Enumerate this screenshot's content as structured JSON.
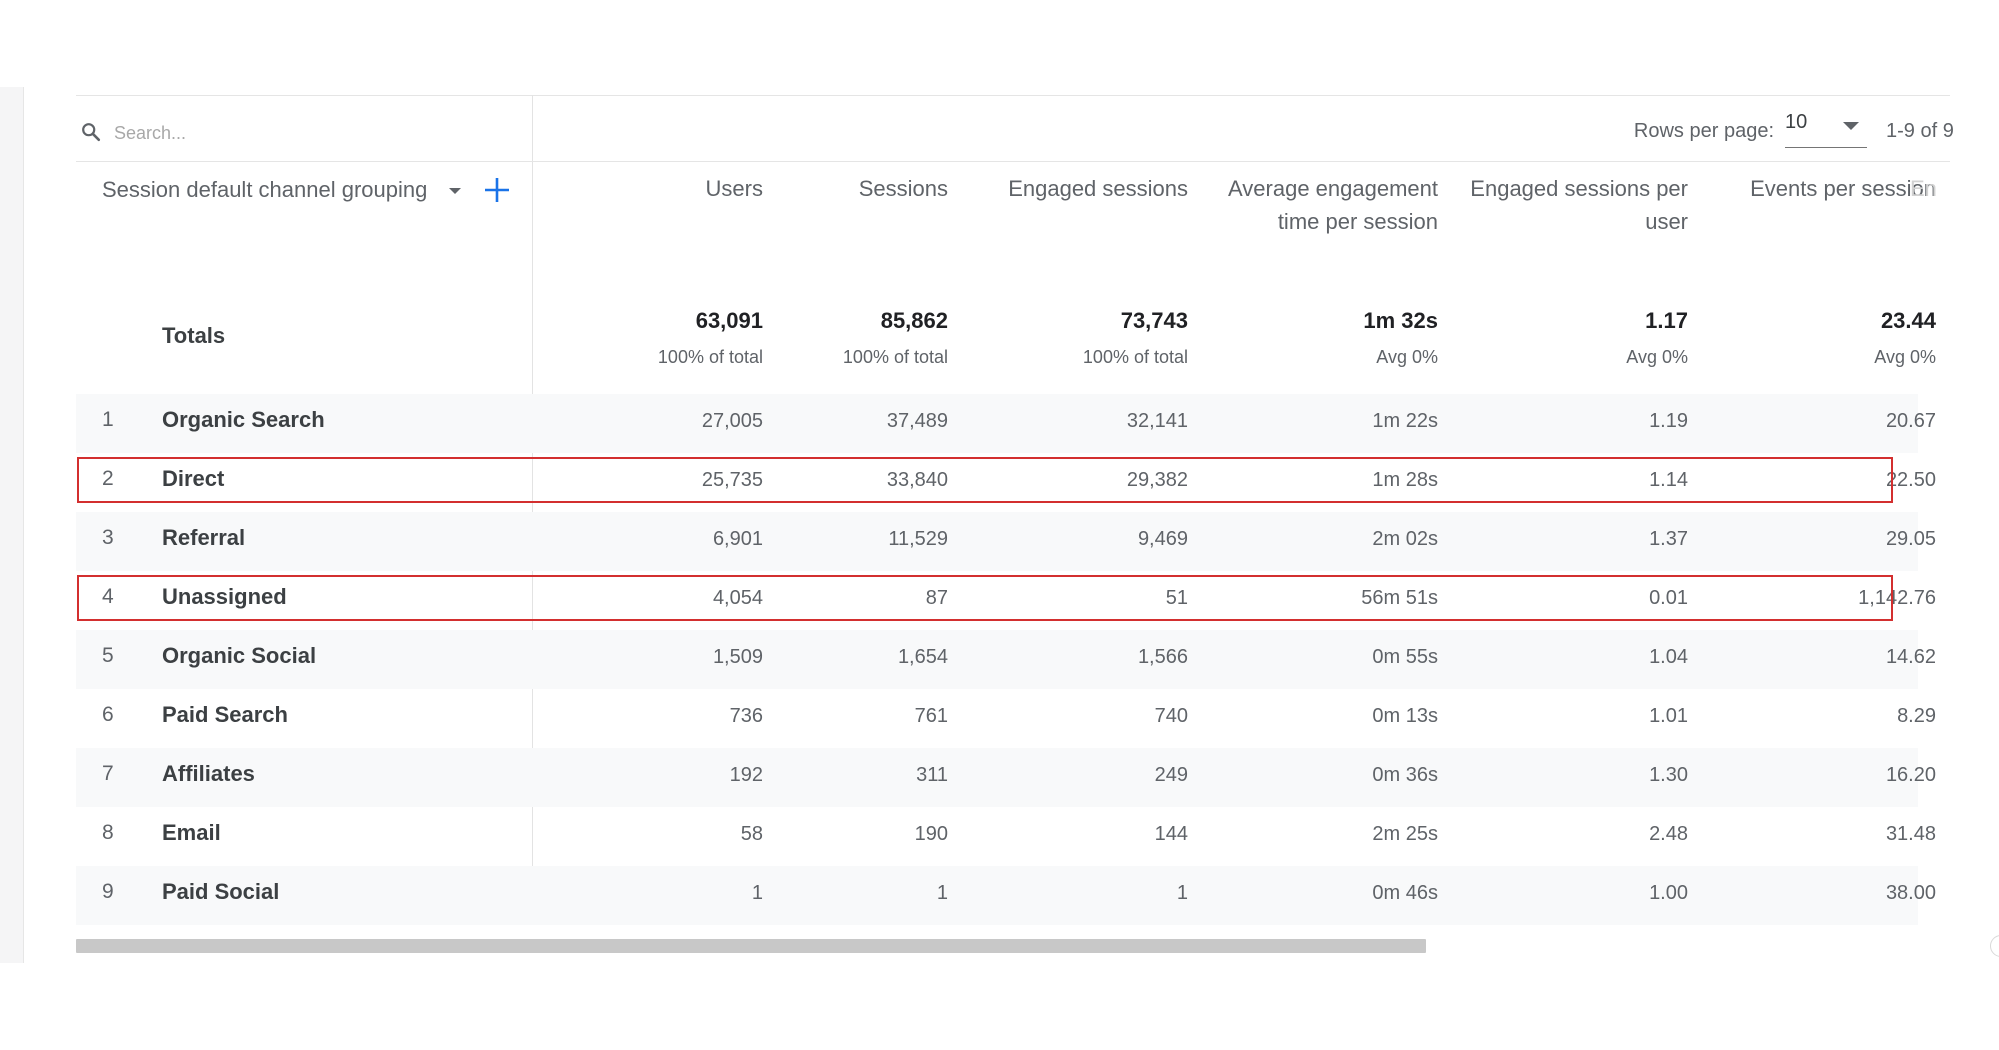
{
  "search": {
    "placeholder": "Search..."
  },
  "pagination": {
    "rows_per_page_label": "Rows per page:",
    "rows_per_page_value": "10",
    "range_text": "1-9 of 9"
  },
  "table": {
    "dimension_header": "Session default channel grouping",
    "columns": [
      {
        "key": "users",
        "label": "Users"
      },
      {
        "key": "sessions",
        "label": "Sessions"
      },
      {
        "key": "engaged_sessions",
        "label": "Engaged sessions"
      },
      {
        "key": "avg_engagement",
        "label": "Average engagement time per session"
      },
      {
        "key": "engaged_per_user",
        "label": "Engaged sessions per user"
      },
      {
        "key": "events_per_session",
        "label": "Events per session"
      },
      {
        "key": "cut_off",
        "label": "En"
      }
    ],
    "totals": {
      "label": "Totals",
      "values": [
        "63,091",
        "85,862",
        "73,743",
        "1m 32s",
        "1.17",
        "23.44"
      ],
      "subs": [
        "100% of total",
        "100% of total",
        "100% of total",
        "Avg 0%",
        "Avg 0%",
        "Avg 0%"
      ]
    },
    "rows": [
      {
        "num": "1",
        "name": "Organic Search",
        "values": [
          "27,005",
          "37,489",
          "32,141",
          "1m 22s",
          "1.19",
          "20.67"
        ],
        "highlighted": false
      },
      {
        "num": "2",
        "name": "Direct",
        "values": [
          "25,735",
          "33,840",
          "29,382",
          "1m 28s",
          "1.14",
          "22.50"
        ],
        "highlighted": true
      },
      {
        "num": "3",
        "name": "Referral",
        "values": [
          "6,901",
          "11,529",
          "9,469",
          "2m 02s",
          "1.37",
          "29.05"
        ],
        "highlighted": false
      },
      {
        "num": "4",
        "name": "Unassigned",
        "values": [
          "4,054",
          "87",
          "51",
          "56m 51s",
          "0.01",
          "1,142.76"
        ],
        "highlighted": true
      },
      {
        "num": "5",
        "name": "Organic Social",
        "values": [
          "1,509",
          "1,654",
          "1,566",
          "0m 55s",
          "1.04",
          "14.62"
        ],
        "highlighted": false
      },
      {
        "num": "6",
        "name": "Paid Search",
        "values": [
          "736",
          "761",
          "740",
          "0m 13s",
          "1.01",
          "8.29"
        ],
        "highlighted": false
      },
      {
        "num": "7",
        "name": "Affiliates",
        "values": [
          "192",
          "311",
          "249",
          "0m 36s",
          "1.30",
          "16.20"
        ],
        "highlighted": false
      },
      {
        "num": "8",
        "name": "Email",
        "values": [
          "58",
          "190",
          "144",
          "2m 25s",
          "2.48",
          "31.48"
        ],
        "highlighted": false
      },
      {
        "num": "9",
        "name": "Paid Social",
        "values": [
          "1",
          "1",
          "1",
          "0m 46s",
          "1.00",
          "38.00"
        ],
        "highlighted": false
      }
    ]
  },
  "colors": {
    "highlight_border": "#d32f2f",
    "accent_blue": "#1a73e8",
    "row_shade": "#f8f9fa"
  },
  "icons": {
    "search": "search-icon",
    "dropdown": "caret-down-icon",
    "add": "plus-icon"
  }
}
